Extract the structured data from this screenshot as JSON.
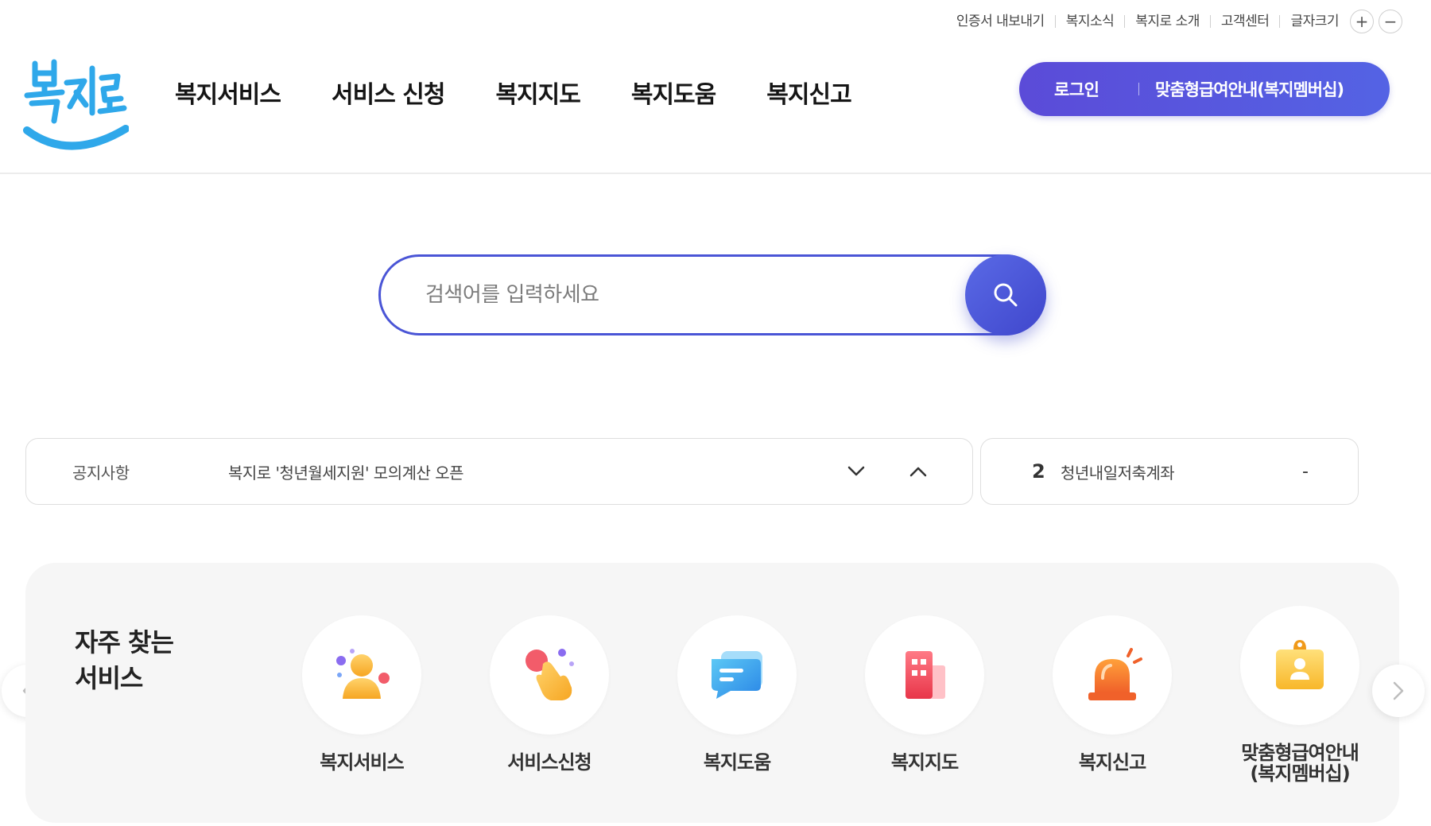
{
  "utility": {
    "links": [
      "인증서 내보내기",
      "복지소식",
      "복지로 소개",
      "고객센터"
    ],
    "font_size_label": "글자크기",
    "plus": "+",
    "minus": "−"
  },
  "logo": {
    "alt": "복지로"
  },
  "nav": {
    "items": [
      "복지서비스",
      "서비스 신청",
      "복지지도",
      "복지도움",
      "복지신고"
    ]
  },
  "auth": {
    "login": "로그인",
    "membership": "맞춤형급여안내(복지멤버십)"
  },
  "search": {
    "placeholder": "검색어를 입력하세요",
    "button_icon": "search-icon"
  },
  "notice": {
    "label": "공지사항",
    "text": "복지로 '청년월세지원' 모의계산 오픈"
  },
  "ranking": {
    "rank": "2",
    "keyword": "청년내일저축계좌",
    "change": "-"
  },
  "favorites": {
    "title_line1": "자주 찾는",
    "title_line2": "서비스",
    "items": [
      {
        "label": "복지서비스",
        "icon": "person-icon"
      },
      {
        "label": "서비스신청",
        "icon": "hand-tap-icon"
      },
      {
        "label": "복지도움",
        "icon": "chat-document-icon"
      },
      {
        "label": "복지지도",
        "icon": "building-icon"
      },
      {
        "label": "복지신고",
        "icon": "siren-icon"
      },
      {
        "label": "맞춤형급여안내",
        "label2": "(복지멤버십)",
        "icon": "id-card-icon"
      }
    ]
  },
  "colors": {
    "primary": "#4a55d6",
    "logo_blue": "#2fa8ea",
    "background": "#f6f6f6"
  }
}
